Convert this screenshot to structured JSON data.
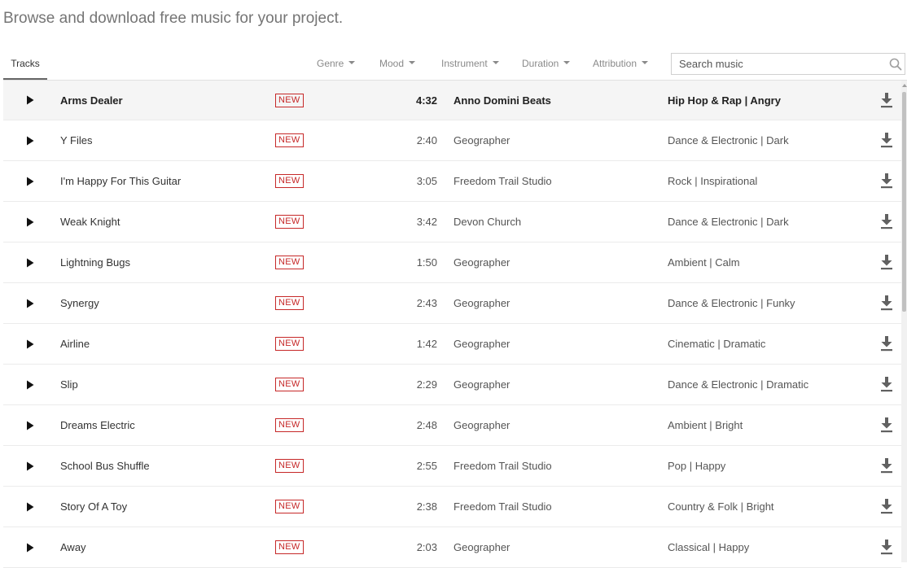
{
  "header": {
    "headline": "Browse and download free music for your project."
  },
  "toolbar": {
    "tab_label": "Tracks",
    "filters": [
      "Genre",
      "Mood",
      "Instrument",
      "Duration",
      "Attribution"
    ],
    "search_placeholder": "Search music"
  },
  "icons": {
    "play": "play-icon",
    "download": "download-icon",
    "search": "search-icon",
    "dropdown": "caret-down-icon"
  },
  "colors": {
    "new_badge": "#c62828",
    "active_row_bg": "#f5f5f5",
    "tab_underline": "#666666"
  },
  "tracks": [
    {
      "title": "Arms Dealer",
      "badge": "NEW",
      "duration": "4:32",
      "artist": "Anno Domini Beats",
      "genre": "Hip Hop & Rap | Angry"
    },
    {
      "title": "Y Files",
      "badge": "NEW",
      "duration": "2:40",
      "artist": "Geographer",
      "genre": "Dance & Electronic | Dark"
    },
    {
      "title": "I'm Happy For This Guitar",
      "badge": "NEW",
      "duration": "3:05",
      "artist": "Freedom Trail Studio",
      "genre": "Rock | Inspirational"
    },
    {
      "title": "Weak Knight",
      "badge": "NEW",
      "duration": "3:42",
      "artist": "Devon Church",
      "genre": "Dance & Electronic | Dark"
    },
    {
      "title": "Lightning Bugs",
      "badge": "NEW",
      "duration": "1:50",
      "artist": "Geographer",
      "genre": "Ambient | Calm"
    },
    {
      "title": "Synergy",
      "badge": "NEW",
      "duration": "2:43",
      "artist": "Geographer",
      "genre": "Dance & Electronic | Funky"
    },
    {
      "title": "Airline",
      "badge": "NEW",
      "duration": "1:42",
      "artist": "Geographer",
      "genre": "Cinematic | Dramatic"
    },
    {
      "title": "Slip",
      "badge": "NEW",
      "duration": "2:29",
      "artist": "Geographer",
      "genre": "Dance & Electronic | Dramatic"
    },
    {
      "title": "Dreams Electric",
      "badge": "NEW",
      "duration": "2:48",
      "artist": "Geographer",
      "genre": "Ambient | Bright"
    },
    {
      "title": "School Bus Shuffle",
      "badge": "NEW",
      "duration": "2:55",
      "artist": "Freedom Trail Studio",
      "genre": "Pop | Happy"
    },
    {
      "title": "Story Of A Toy",
      "badge": "NEW",
      "duration": "2:38",
      "artist": "Freedom Trail Studio",
      "genre": "Country & Folk | Bright"
    },
    {
      "title": "Away",
      "badge": "NEW",
      "duration": "2:03",
      "artist": "Geographer",
      "genre": "Classical | Happy"
    }
  ]
}
